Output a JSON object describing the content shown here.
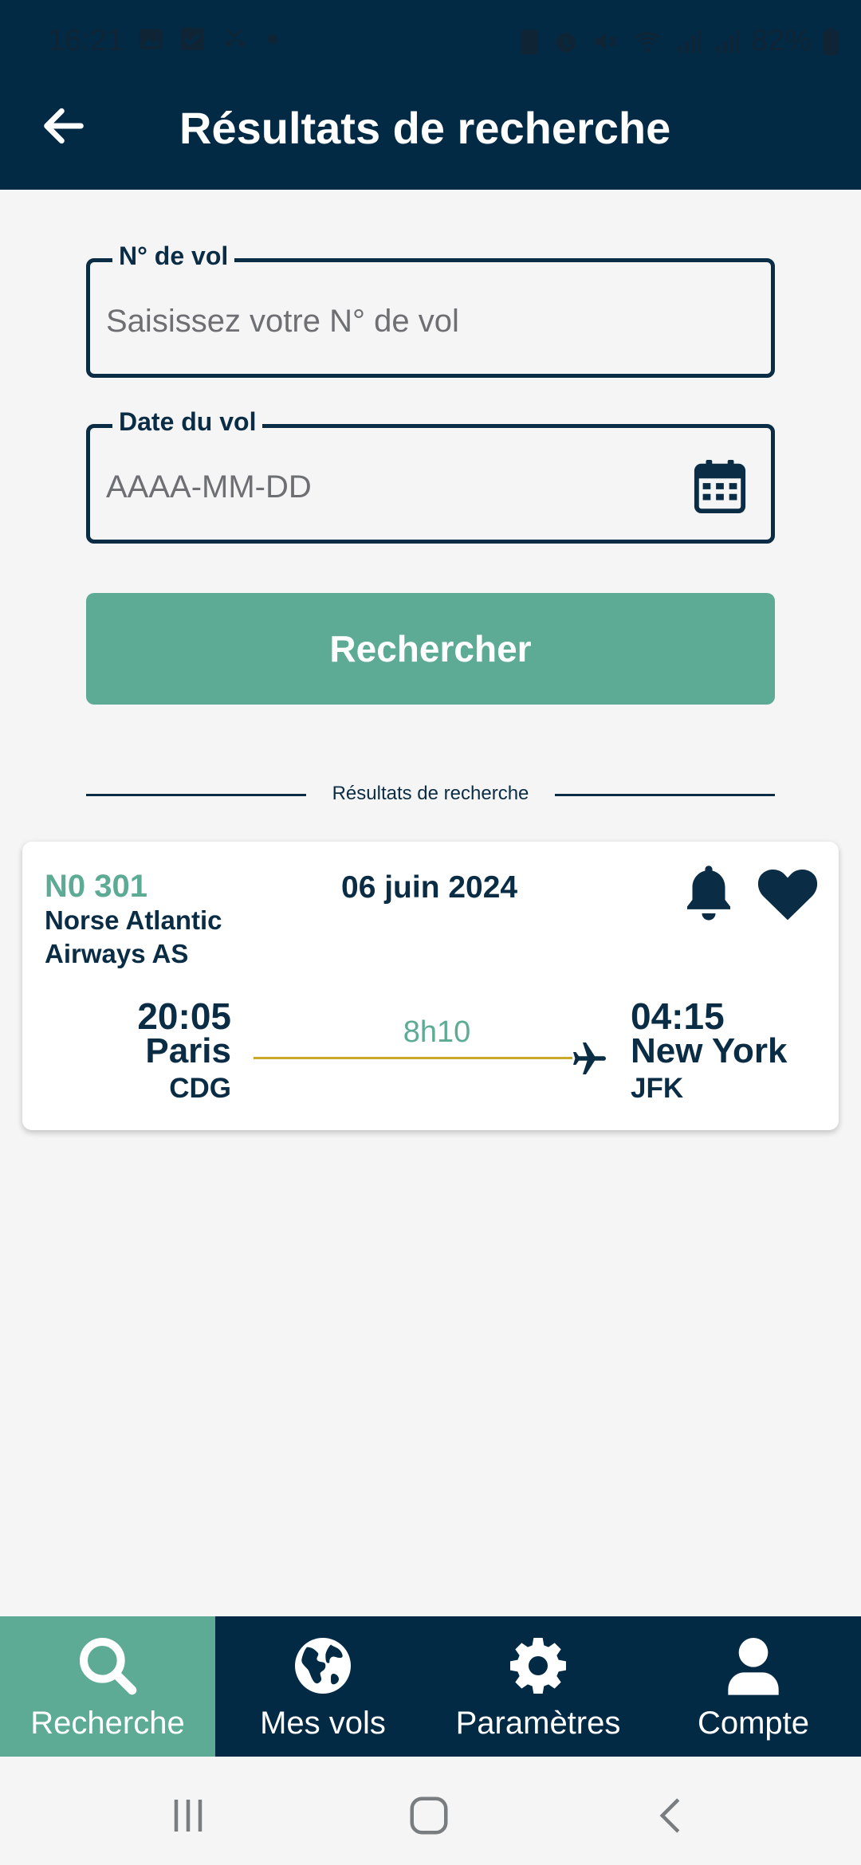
{
  "status_bar": {
    "time": "16:21",
    "battery": "82%"
  },
  "appbar": {
    "title": "Résultats de recherche"
  },
  "form": {
    "flight_number": {
      "label": "N° de vol",
      "placeholder": "Saisissez votre N° de vol"
    },
    "flight_date": {
      "label": "Date du vol",
      "placeholder": "AAAA-MM-DD"
    },
    "search_label": "Rechercher"
  },
  "results": {
    "divider_label": "Résultats de recherche",
    "items": [
      {
        "flight_no": "N0 301",
        "airline": "Norse Atlantic Airways AS",
        "date": "06 juin 2024",
        "departure": {
          "time": "20:05",
          "city": "Paris",
          "code": "CDG"
        },
        "arrival": {
          "time": "04:15",
          "city": "New York",
          "code": "JFK"
        },
        "duration": "8h10"
      }
    ]
  },
  "bottom_nav": {
    "items": [
      {
        "label": "Recherche",
        "icon": "search-icon",
        "active": true
      },
      {
        "label": "Mes vols",
        "icon": "globe-icon",
        "active": false
      },
      {
        "label": "Paramètres",
        "icon": "gear-icon",
        "active": false
      },
      {
        "label": "Compte",
        "icon": "user-icon",
        "active": false
      }
    ]
  },
  "colors": {
    "primary": "#032a45",
    "accent": "#5eab95",
    "route": "#c9a82a"
  }
}
